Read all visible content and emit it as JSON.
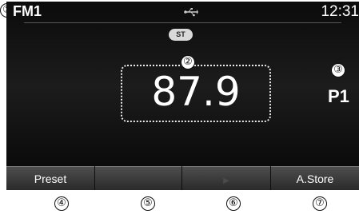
{
  "callouts": {
    "c1": "①",
    "c2": "②",
    "c3": "③",
    "c4": "④",
    "c5": "⑤",
    "c6": "⑥",
    "c7": "⑦"
  },
  "status": {
    "band": "FM1",
    "clock": "12:31",
    "stereo": "ST",
    "usb_icon": "usb-icon"
  },
  "tuner": {
    "frequency": "87.9",
    "preset": "P1"
  },
  "softkeys": [
    {
      "label": "Preset",
      "enabled": true
    },
    {
      "label": "",
      "enabled": false
    },
    {
      "label": "",
      "enabled": false
    },
    {
      "label": "A.Store",
      "enabled": true
    }
  ],
  "colors": {
    "screen_bg": "#111111",
    "text": "#ffffff",
    "key_bg": "#3a3a3a"
  }
}
